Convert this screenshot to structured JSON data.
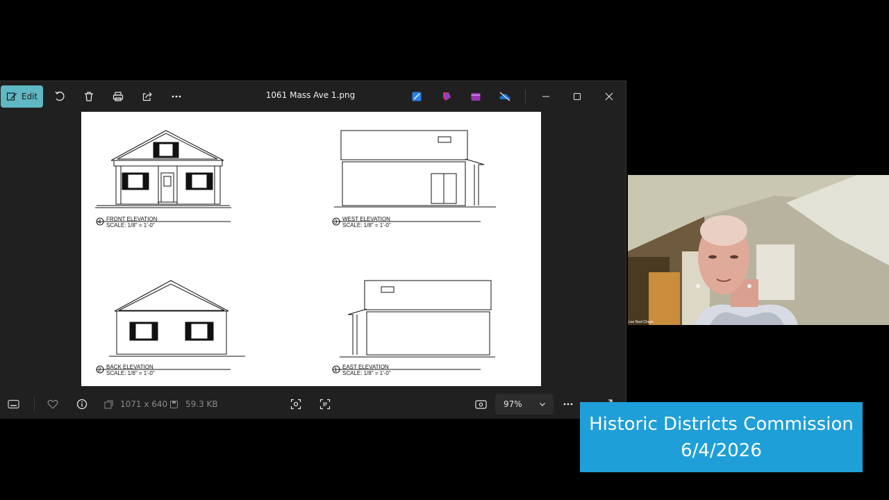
{
  "window": {
    "title": "1061 Mass Ave 1.png",
    "toolbar": {
      "edit_label": "Edit"
    },
    "info": {
      "dimensions": "1071 x 640",
      "file_size": "59.3 KB",
      "zoom": "97%"
    }
  },
  "drawing": {
    "elevations": [
      {
        "number": "4",
        "name": "FRONT ELEVATION",
        "scale": "SCALE:   1/8\" = 1'-0\""
      },
      {
        "number": "3",
        "name": "WEST ELEVATION",
        "scale": "SCALE:   1/8\" = 1'-0\""
      },
      {
        "number": "2",
        "name": "BACK ELEVATION",
        "scale": "SCALE:   1/8\" = 1'-0\""
      },
      {
        "number": "1",
        "name": "EAST ELEVATION",
        "scale": "SCALE:   1/8\" = 1'-0\""
      }
    ]
  },
  "webcam": {
    "participant_name": "Lee Noel Chase"
  },
  "caption": {
    "line1": "Historic Districts Commission",
    "line2": "6/4/2026"
  },
  "colors": {
    "accent": "#5fb8c4",
    "caption_bg": "#1f9fd8",
    "window_bg": "#202020"
  }
}
